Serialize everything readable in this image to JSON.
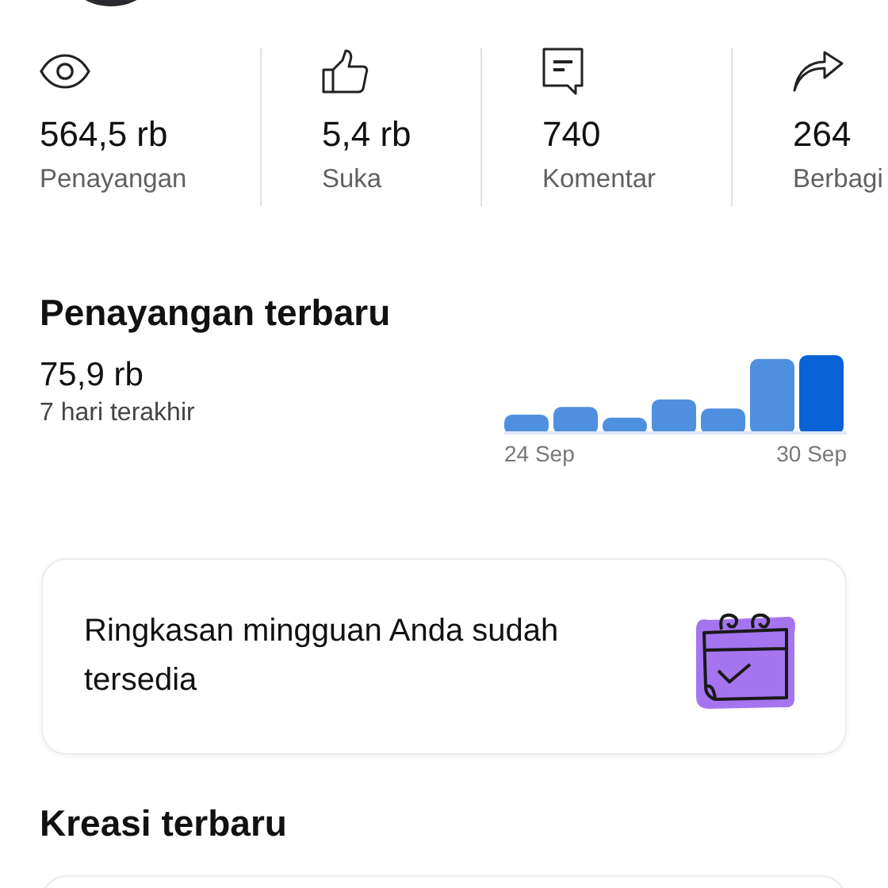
{
  "stats": [
    {
      "kind": "views",
      "value": "564,5 rb",
      "label": "Penayangan"
    },
    {
      "kind": "likes",
      "value": "5,4 rb",
      "label": "Suka"
    },
    {
      "kind": "comments",
      "value": "740",
      "label": "Komentar"
    },
    {
      "kind": "shares",
      "value": "264",
      "label": "Berbagi"
    }
  ],
  "recent_views": {
    "title": "Penayangan terbaru",
    "value": "75,9 rb",
    "period": "7 hari terakhir",
    "start_label": "24 Sep",
    "end_label": "30 Sep"
  },
  "summary_card": {
    "text": "Ringkasan mingguan Anda sudah tersedia"
  },
  "recent_creations": {
    "title": "Kreasi terbaru"
  }
}
